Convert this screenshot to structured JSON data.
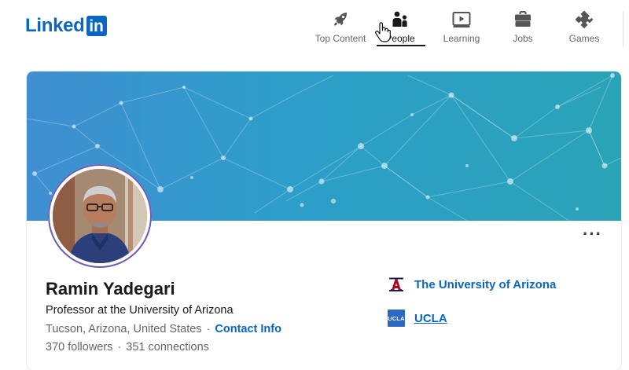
{
  "brand": {
    "logo_text": "Linked",
    "logo_box": "in",
    "color": "#0a66c2"
  },
  "nav": {
    "items": [
      {
        "label": "Top Content",
        "icon": "rocket-icon"
      },
      {
        "label": "People",
        "icon": "people-icon",
        "active": true
      },
      {
        "label": "Learning",
        "icon": "video-player-icon"
      },
      {
        "label": "Jobs",
        "icon": "briefcase-icon"
      },
      {
        "label": "Games",
        "icon": "puzzle-icon"
      }
    ]
  },
  "profile": {
    "name": "Ramin Yadegari",
    "headline": "Professor at the University of Arizona",
    "location": "Tucson, Arizona, United States",
    "separator": "·",
    "contact_info": "Contact Info",
    "followers": "370 followers",
    "connections": "351 connections",
    "more_label": "···",
    "organizations": [
      {
        "name": "The University of Arizona",
        "logo": "arizona-a-logo",
        "logo_color": "#ab0520"
      },
      {
        "name": "UCLA",
        "logo": "ucla-logo",
        "logo_text": "UCLA",
        "logo_color": "#2d68c4"
      }
    ]
  },
  "colors": {
    "banner_start": "#3f8fd1",
    "banner_end": "#2aa3b7",
    "link": "#0a66c2"
  }
}
